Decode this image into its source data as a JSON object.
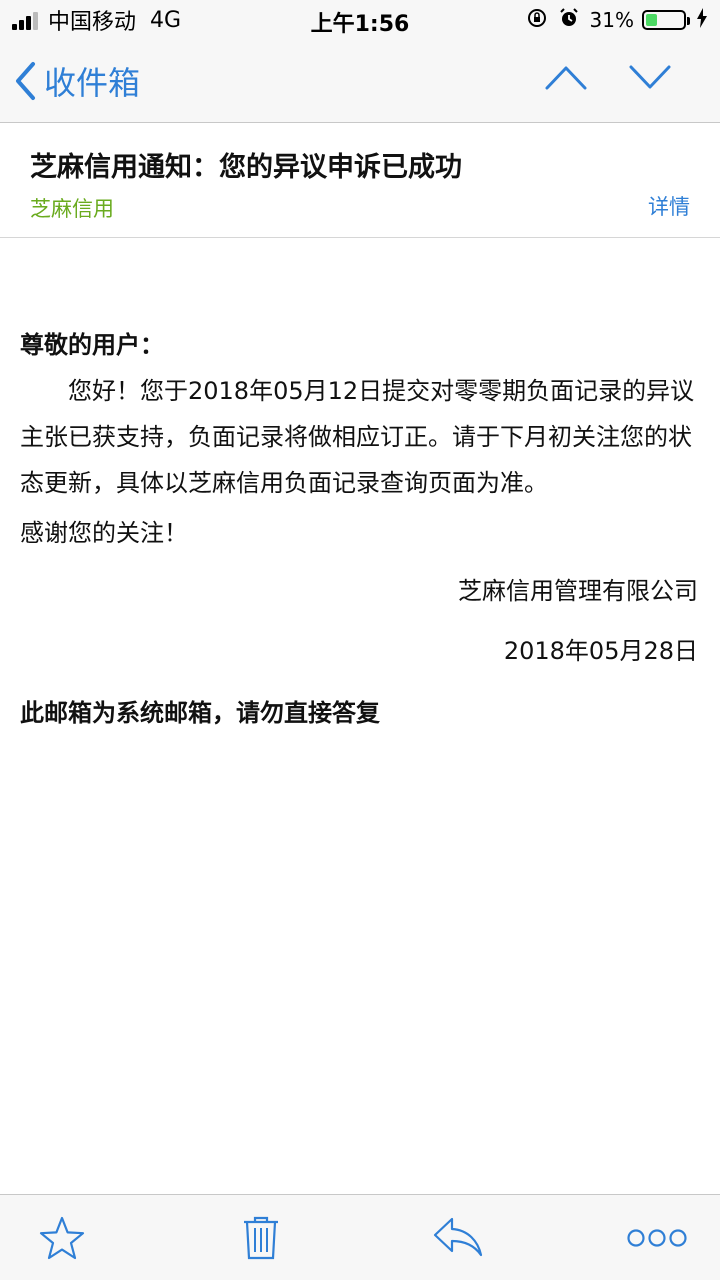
{
  "status_bar": {
    "carrier": "中国移动",
    "network": "4G",
    "time": "上午1:56",
    "battery_percent_label": "31%",
    "battery_level": 0.31
  },
  "nav": {
    "back_label": "收件箱",
    "prev_icon": "chevron-up-icon",
    "next_icon": "chevron-down-icon"
  },
  "mail": {
    "subject": "芝麻信用通知：您的异议申诉已成功",
    "sender": "芝麻信用",
    "details_label": "详情",
    "greeting": "尊敬的用户：",
    "paragraph": "您好！您于2018年05月12日提交对零零期负面记录的异议主张已获支持，负面记录将做相应订正。请于下月初关注您的状态更新，具体以芝麻信用负面记录查询页面为准。",
    "thanks": "感谢您的关注！",
    "signature_company": "芝麻信用管理有限公司",
    "signature_date": "2018年05月28日",
    "notice": "此邮箱为系统邮箱，请勿直接答复"
  },
  "toolbar": {
    "icons": [
      "star-icon",
      "trash-icon",
      "reply-icon",
      "more-icon"
    ]
  },
  "colors": {
    "accent": "#2f7fd6",
    "sender": "#6aab1f",
    "battery": "#4cd964"
  }
}
